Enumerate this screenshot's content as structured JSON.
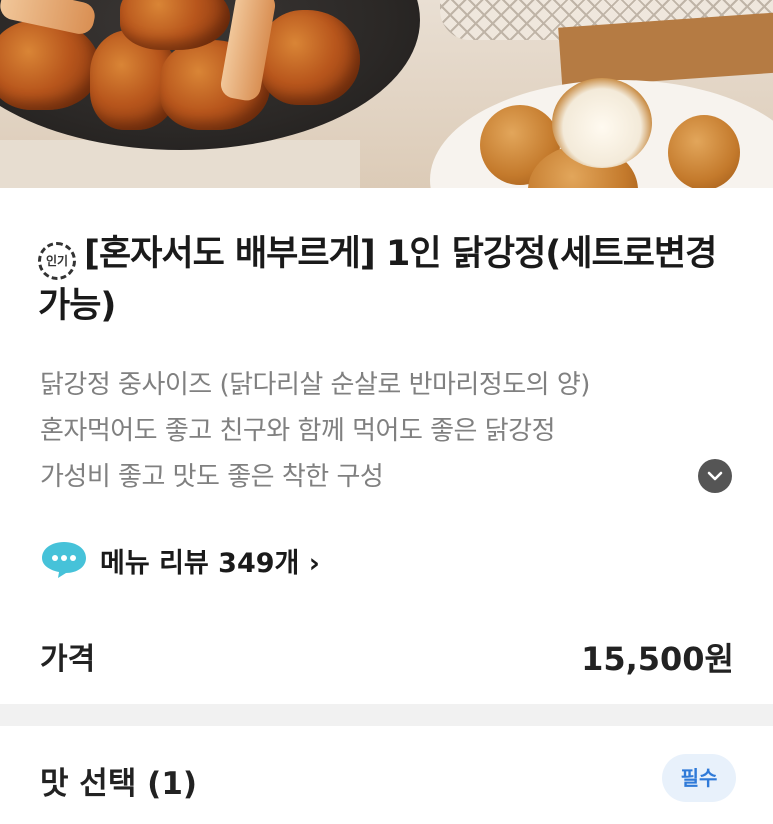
{
  "hero": {
    "description": ""
  },
  "product": {
    "badge_text": "인기",
    "title": "[혼자서도 배부르게] 1인 닭강정(세트로변경가능)",
    "description_lines": [
      "닭강정 중사이즈 (닭다리살 순살로 반마리정도의 양)",
      "혼자먹어도 좋고 친구와 함께 먹어도 좋은 닭강정",
      "가성비 좋고 맛도 좋은 착한 구성"
    ],
    "expand_icon": "chevron-down-icon"
  },
  "review": {
    "label": "메뉴 리뷰 349개 ›",
    "icon": "chat-bubble-icon"
  },
  "price": {
    "label": "가격",
    "value": "15,500원"
  },
  "option": {
    "title": "맛 선택 (1)",
    "required_label": "필수"
  },
  "colors": {
    "required_bg": "#e8f1fb",
    "required_text": "#2f7ad8",
    "review_icon": "#46c2d9"
  }
}
